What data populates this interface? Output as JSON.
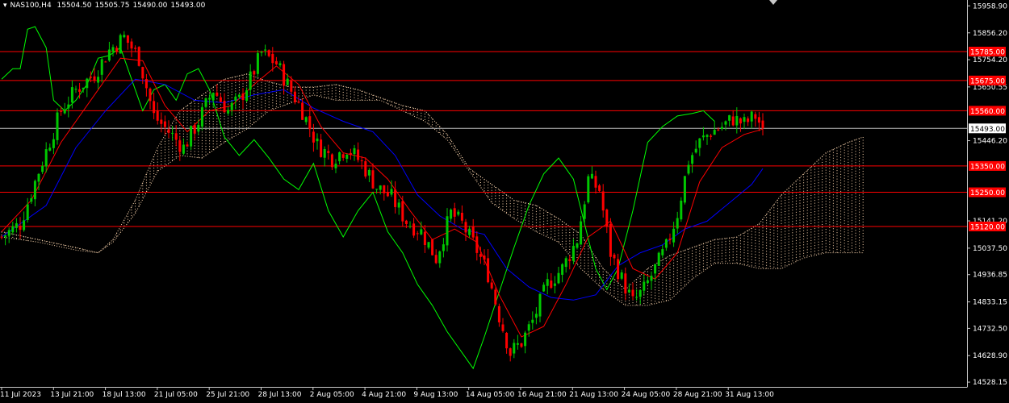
{
  "header": {
    "symbol_timeframe": "NAS100,H4",
    "open": "15504.50",
    "high": "15505.75",
    "low": "15490.00",
    "close": "15493.00"
  },
  "colors": {
    "background": "#000000",
    "axis": "#c8c8c8",
    "bull_candle": "#00c800",
    "bear_candle": "#ff0000",
    "tenkan": "#ff0000",
    "kijun": "#0000ff",
    "chikou": "#00ff00",
    "cloud": "#ffd8b0",
    "level_line": "#ff0000",
    "level_label_bg": "#ff0000",
    "price_line": "#c0c0c0",
    "price_label_bg": "#ffffff"
  },
  "chart_data": {
    "type": "candlestick",
    "title": "NAS100,H4",
    "x_ticks": [
      "11 Jul 2023",
      "13 Jul 21:00",
      "18 Jul 13:00",
      "21 Jul 05:00",
      "25 Jul 21:00",
      "28 Jul 13:00",
      "2 Aug 05:00",
      "4 Aug 21:00",
      "9 Aug 13:00",
      "14 Aug 05:00",
      "16 Aug 21:00",
      "21 Aug 13:00",
      "24 Aug 05:00",
      "28 Aug 21:00",
      "31 Aug 13:00"
    ],
    "y_ticks": [
      "15958.90",
      "15856.20",
      "15754.20",
      "15650.55",
      "15446.20",
      "15141.20",
      "15037.50",
      "14936.85",
      "14833.15",
      "14732.50",
      "14628.90",
      "14528.15"
    ],
    "ylim": [
      14510,
      15975
    ],
    "levels": [
      {
        "label": "15785.00",
        "value": 15785
      },
      {
        "label": "15675.00",
        "value": 15675
      },
      {
        "label": "15560.00",
        "value": 15560
      },
      {
        "label": "15350.00",
        "value": 15350
      },
      {
        "label": "15250.00",
        "value": 15250
      },
      {
        "label": "15120.00",
        "value": 15120
      }
    ],
    "current_price": {
      "label": "15493.00",
      "value": 15493
    },
    "price_path": [
      [
        0,
        15080
      ],
      [
        5,
        15130
      ],
      [
        10,
        15330
      ],
      [
        16,
        15560
      ],
      [
        20,
        15640
      ],
      [
        25,
        15700
      ],
      [
        29,
        15790
      ],
      [
        33,
        15840
      ],
      [
        37,
        15760
      ],
      [
        41,
        15540
      ],
      [
        45,
        15480
      ],
      [
        49,
        15420
      ],
      [
        53,
        15520
      ],
      [
        57,
        15640
      ],
      [
        61,
        15560
      ],
      [
        64,
        15600
      ],
      [
        67,
        15680
      ],
      [
        70,
        15780
      ],
      [
        74,
        15740
      ],
      [
        77,
        15660
      ],
      [
        81,
        15560
      ],
      [
        85,
        15430
      ],
      [
        89,
        15380
      ],
      [
        93,
        15420
      ],
      [
        97,
        15360
      ],
      [
        101,
        15270
      ],
      [
        105,
        15230
      ],
      [
        109,
        15140
      ],
      [
        113,
        15100
      ],
      [
        117,
        15000
      ],
      [
        121,
        15170
      ],
      [
        124,
        15130
      ],
      [
        128,
        15030
      ],
      [
        131,
        14940
      ],
      [
        134,
        14780
      ],
      [
        137,
        14640
      ],
      [
        140,
        14680
      ],
      [
        143,
        14760
      ],
      [
        147,
        14900
      ],
      [
        151,
        14960
      ],
      [
        155,
        15070
      ],
      [
        158,
        15300
      ],
      [
        161,
        15260
      ],
      [
        164,
        15020
      ],
      [
        167,
        14920
      ],
      [
        170,
        14830
      ],
      [
        173,
        14880
      ],
      [
        176,
        14960
      ],
      [
        179,
        15040
      ],
      [
        182,
        15170
      ],
      [
        185,
        15370
      ],
      [
        188,
        15440
      ],
      [
        191,
        15480
      ],
      [
        194,
        15500
      ],
      [
        197,
        15530
      ],
      [
        200,
        15510
      ],
      [
        203,
        15540
      ],
      [
        205,
        15493
      ]
    ],
    "tenkan_path": [
      [
        0,
        15100
      ],
      [
        8,
        15220
      ],
      [
        16,
        15440
      ],
      [
        24,
        15600
      ],
      [
        32,
        15760
      ],
      [
        38,
        15750
      ],
      [
        44,
        15580
      ],
      [
        50,
        15480
      ],
      [
        56,
        15560
      ],
      [
        62,
        15580
      ],
      [
        68,
        15660
      ],
      [
        74,
        15730
      ],
      [
        80,
        15660
      ],
      [
        86,
        15500
      ],
      [
        92,
        15400
      ],
      [
        98,
        15380
      ],
      [
        104,
        15300
      ],
      [
        110,
        15180
      ],
      [
        116,
        15070
      ],
      [
        122,
        15110
      ],
      [
        128,
        15060
      ],
      [
        134,
        14860
      ],
      [
        140,
        14700
      ],
      [
        146,
        14740
      ],
      [
        152,
        14900
      ],
      [
        158,
        15080
      ],
      [
        164,
        15140
      ],
      [
        170,
        14960
      ],
      [
        176,
        14920
      ],
      [
        182,
        15020
      ],
      [
        188,
        15290
      ],
      [
        194,
        15420
      ],
      [
        200,
        15470
      ],
      [
        205,
        15490
      ]
    ],
    "kijun_path": [
      [
        0,
        15080
      ],
      [
        12,
        15200
      ],
      [
        20,
        15420
      ],
      [
        28,
        15560
      ],
      [
        36,
        15680
      ],
      [
        44,
        15660
      ],
      [
        52,
        15600
      ],
      [
        60,
        15590
      ],
      [
        68,
        15620
      ],
      [
        76,
        15640
      ],
      [
        84,
        15570
      ],
      [
        92,
        15520
      ],
      [
        100,
        15480
      ],
      [
        106,
        15390
      ],
      [
        112,
        15240
      ],
      [
        118,
        15160
      ],
      [
        124,
        15110
      ],
      [
        130,
        15090
      ],
      [
        136,
        14960
      ],
      [
        142,
        14890
      ],
      [
        148,
        14850
      ],
      [
        154,
        14840
      ],
      [
        160,
        14860
      ],
      [
        166,
        14970
      ],
      [
        172,
        15020
      ],
      [
        178,
        15050
      ],
      [
        184,
        15110
      ],
      [
        190,
        15140
      ],
      [
        196,
        15210
      ],
      [
        202,
        15280
      ],
      [
        205,
        15340
      ]
    ],
    "chikou_path": [
      [
        0,
        15680
      ],
      [
        3,
        15720
      ],
      [
        5,
        15720
      ],
      [
        7,
        15870
      ],
      [
        9,
        15880
      ],
      [
        12,
        15800
      ],
      [
        14,
        15600
      ],
      [
        17,
        15560
      ],
      [
        20,
        15600
      ],
      [
        23,
        15660
      ],
      [
        26,
        15760
      ],
      [
        29,
        15770
      ],
      [
        32,
        15800
      ],
      [
        35,
        15680
      ],
      [
        38,
        15560
      ],
      [
        41,
        15640
      ],
      [
        44,
        15660
      ],
      [
        47,
        15600
      ],
      [
        50,
        15700
      ],
      [
        53,
        15720
      ],
      [
        56,
        15640
      ],
      [
        60,
        15460
      ],
      [
        64,
        15390
      ],
      [
        68,
        15450
      ],
      [
        72,
        15380
      ],
      [
        76,
        15300
      ],
      [
        80,
        15260
      ],
      [
        84,
        15360
      ],
      [
        88,
        15180
      ],
      [
        92,
        15080
      ],
      [
        96,
        15180
      ],
      [
        100,
        15250
      ],
      [
        104,
        15100
      ],
      [
        108,
        15020
      ],
      [
        112,
        14900
      ],
      [
        116,
        14820
      ],
      [
        120,
        14720
      ],
      [
        124,
        14640
      ],
      [
        127,
        14580
      ],
      [
        130,
        14700
      ],
      [
        134,
        14870
      ],
      [
        138,
        15040
      ],
      [
        142,
        15200
      ],
      [
        146,
        15320
      ],
      [
        150,
        15380
      ],
      [
        154,
        15300
      ],
      [
        157,
        15130
      ],
      [
        160,
        14960
      ],
      [
        163,
        14880
      ],
      [
        166,
        14960
      ],
      [
        170,
        15180
      ],
      [
        174,
        15440
      ],
      [
        178,
        15500
      ],
      [
        182,
        15540
      ],
      [
        186,
        15550
      ],
      [
        189,
        15560
      ],
      [
        192,
        15520
      ]
    ],
    "cloud_a": [
      [
        0,
        15100
      ],
      [
        10,
        15070
      ],
      [
        20,
        15040
      ],
      [
        26,
        15020
      ],
      [
        30,
        15070
      ],
      [
        36,
        15220
      ],
      [
        42,
        15420
      ],
      [
        48,
        15560
      ],
      [
        54,
        15620
      ],
      [
        60,
        15680
      ],
      [
        66,
        15700
      ],
      [
        72,
        15670
      ],
      [
        78,
        15650
      ],
      [
        84,
        15650
      ],
      [
        90,
        15660
      ],
      [
        96,
        15640
      ],
      [
        102,
        15610
      ],
      [
        108,
        15580
      ],
      [
        114,
        15560
      ],
      [
        120,
        15470
      ],
      [
        126,
        15340
      ],
      [
        132,
        15280
      ],
      [
        138,
        15220
      ],
      [
        144,
        15200
      ],
      [
        150,
        15150
      ],
      [
        156,
        15090
      ],
      [
        162,
        14960
      ],
      [
        168,
        14880
      ],
      [
        174,
        14960
      ],
      [
        180,
        15010
      ],
      [
        186,
        15040
      ],
      [
        192,
        15070
      ],
      [
        198,
        15080
      ],
      [
        204,
        15130
      ],
      [
        210,
        15240
      ],
      [
        216,
        15320
      ],
      [
        222,
        15400
      ],
      [
        228,
        15440
      ],
      [
        232,
        15460
      ]
    ],
    "cloud_b": [
      [
        0,
        15080
      ],
      [
        10,
        15060
      ],
      [
        20,
        15030
      ],
      [
        26,
        15020
      ],
      [
        30,
        15060
      ],
      [
        36,
        15170
      ],
      [
        42,
        15330
      ],
      [
        48,
        15390
      ],
      [
        54,
        15380
      ],
      [
        60,
        15440
      ],
      [
        66,
        15490
      ],
      [
        72,
        15560
      ],
      [
        78,
        15590
      ],
      [
        84,
        15620
      ],
      [
        90,
        15600
      ],
      [
        96,
        15600
      ],
      [
        102,
        15600
      ],
      [
        108,
        15560
      ],
      [
        114,
        15520
      ],
      [
        120,
        15450
      ],
      [
        126,
        15330
      ],
      [
        132,
        15210
      ],
      [
        138,
        15150
      ],
      [
        144,
        15100
      ],
      [
        150,
        15060
      ],
      [
        156,
        14960
      ],
      [
        162,
        14880
      ],
      [
        168,
        14820
      ],
      [
        174,
        14820
      ],
      [
        180,
        14840
      ],
      [
        186,
        14920
      ],
      [
        192,
        14980
      ],
      [
        198,
        14980
      ],
      [
        204,
        14960
      ],
      [
        210,
        14960
      ],
      [
        216,
        15000
      ],
      [
        222,
        15020
      ],
      [
        228,
        15020
      ],
      [
        232,
        15020
      ]
    ]
  }
}
